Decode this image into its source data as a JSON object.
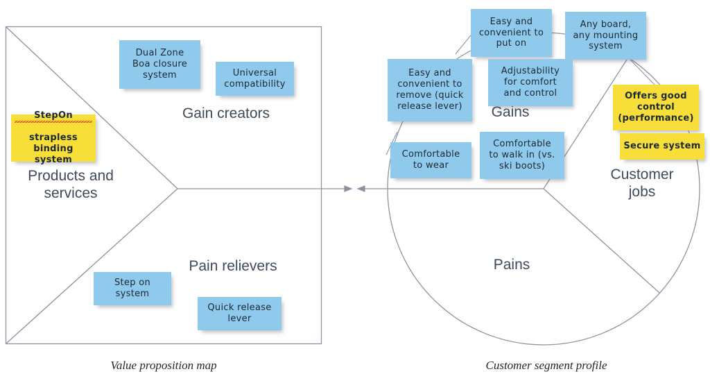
{
  "diagram": {
    "title_left": "Value proposition map",
    "title_right": "Customer segment profile",
    "colors": {
      "note_blue": "#8FC9EC",
      "note_yellow": "#F7DE38",
      "line": "#8A94A0",
      "label_text": "#3E4A59",
      "spellcheck_underline": "#E03020"
    }
  },
  "value_proposition_map": {
    "sections": {
      "products_and_services": "Products and\nservices",
      "gain_creators": "Gain creators",
      "pain_relievers": "Pain relievers"
    },
    "notes": [
      {
        "text": "Dual Zone\nBoa closure\nsystem",
        "color": "blue",
        "section": "gain_creators"
      },
      {
        "text": "Universal\ncompatibility",
        "color": "blue",
        "section": "gain_creators"
      },
      {
        "text": "StepOn\nstrapless\nbinding system",
        "color": "yellow",
        "section": "products_and_services",
        "spellcheck_word": "StepOn"
      },
      {
        "text": "Step on\nsystem",
        "color": "blue",
        "section": "pain_relievers"
      },
      {
        "text": "Quick release\nlever",
        "color": "blue",
        "section": "pain_relievers"
      }
    ]
  },
  "customer_segment_profile": {
    "sections": {
      "gains": "Gains",
      "pains": "Pains",
      "customer_jobs": "Customer\njobs"
    },
    "notes": [
      {
        "text": "Easy and\nconvenient to\nput on",
        "color": "blue",
        "section": "gains"
      },
      {
        "text": "Any board,\nany mounting\nsystem",
        "color": "blue",
        "section": "gains"
      },
      {
        "text": "Easy and\nconvenient to\nremove (quick\nrelease lever)",
        "color": "blue",
        "section": "gains"
      },
      {
        "text": "Adjustability\nfor comfort\nand control",
        "color": "blue",
        "section": "gains"
      },
      {
        "text": "Comfortable\nto wear",
        "color": "blue",
        "section": "gains"
      },
      {
        "text": "Comfortable\nto walk in (vs.\nski boots)",
        "color": "blue",
        "section": "gains"
      },
      {
        "text": "Offers good\ncontrol\n(performance)",
        "color": "yellow",
        "section": "customer_jobs"
      },
      {
        "text": "Secure system",
        "color": "yellow",
        "section": "customer_jobs"
      }
    ]
  }
}
